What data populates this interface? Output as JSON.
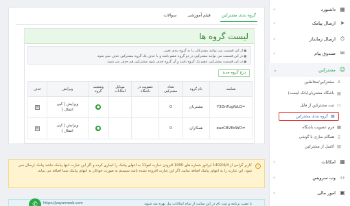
{
  "sidebar": {
    "items": [
      {
        "label": "داشبورد",
        "icon": "dashboard-icon",
        "glyph": "▦"
      },
      {
        "label": "ارسال پیامک",
        "icon": "send-icon",
        "glyph": "➤"
      },
      {
        "label": "ارسال زماندار",
        "icon": "clock-send-icon",
        "glyph": "⏱"
      },
      {
        "label": "صندوق پیام",
        "icon": "inbox-icon",
        "glyph": "✉"
      },
      {
        "label": "مشترکین",
        "icon": "users-icon",
        "glyph": "👥"
      }
    ],
    "sub_items": [
      {
        "label": "مشترکین/مخاطبین",
        "icon": "contacts-icon",
        "glyph": "👤"
      },
      {
        "label": "باشگاه مشتریان(بانک لیست)",
        "icon": "club-icon",
        "glyph": "▤"
      },
      {
        "label": "ثبت مشترکین از فایل",
        "icon": "file-icon",
        "glyph": "▭"
      },
      {
        "label": "گروه بندی مشترکین",
        "icon": "group-icon",
        "glyph": "▤"
      },
      {
        "label": "فرم عضویت باشگاه",
        "icon": "form-icon",
        "glyph": "▦"
      },
      {
        "label": "همگام سازی با گوشی",
        "icon": "sync-icon",
        "glyph": "▯"
      },
      {
        "label": "اکسل از مشترکین",
        "icon": "excel-icon",
        "glyph": "▥"
      }
    ],
    "bottom_items": [
      {
        "label": "امکانات",
        "icon": "features-icon",
        "glyph": "▦"
      },
      {
        "label": "وب سرویس",
        "icon": "webservice-icon",
        "glyph": "‹›"
      },
      {
        "label": "امور مالی",
        "icon": "finance-icon",
        "glyph": "▣"
      }
    ]
  },
  "tabs": [
    "گروه بندی مشترکین",
    "فیلم آموزشی",
    "سوالات"
  ],
  "panel": {
    "title": "لیست گروه ها",
    "notes": [
      "از این قسمت می توانید مشترکان را به گروه بندی تغییر.",
      "در این قسمت می توانید مشترکین در دو گروه عضو باشد و با حذف یک گروه مشترکین حذف نمی شود.",
      "در این قسمت مشترکین عضو یک گروه باشد و آن گروه حذف شود مشترکین هم حذف می شود."
    ],
    "new_button": "درج گروه جدید"
  },
  "table": {
    "headers": [
      "شناسه",
      "نام گروه",
      "تعداد مشترکین",
      "عضویت در باشگاه",
      "موبایل امکانات",
      "وضعیت گروه",
      "ویرایش",
      "حذف"
    ],
    "rows": [
      {
        "id": "Y3DnFugfbLQ=",
        "name": "مشتریان",
        "count": "0",
        "edit1": "ویرایش",
        "edit2": "کپی",
        "edit3": "انتقال"
      },
      {
        "id": "eazC8VEdWO=",
        "name": "همکاران",
        "count": "0",
        "edit1": "ویرایش",
        "edit2": "کپی",
        "edit3": "انتقال"
      }
    ]
  },
  "alert": {
    "text": "کاربر گرامی از 1402/4/4 ایراتور شماره های 1000 افزودن عبارت لغو11 به انتهای پیامک را اجباری کرده و اگر این عبارت انتها پیامک نباشد پیامک ارسال نمی شود. این عبارت را به انتهای پیامک اضافه نمایید. اگر این عبارت افزوده نشده باشد سیستم به صورت خودکار به انتهای پیامک شما اضافه می نماید."
  },
  "alert2": {
    "text": "با نصب برنامه و ثبت نام در این سایت از تمام امکانات پنل بهره مند شوید",
    "site": "https://payamweb.com"
  },
  "colors": {
    "accent": "#16a34a",
    "highlight": "#e53935",
    "link": "#1976d2"
  }
}
